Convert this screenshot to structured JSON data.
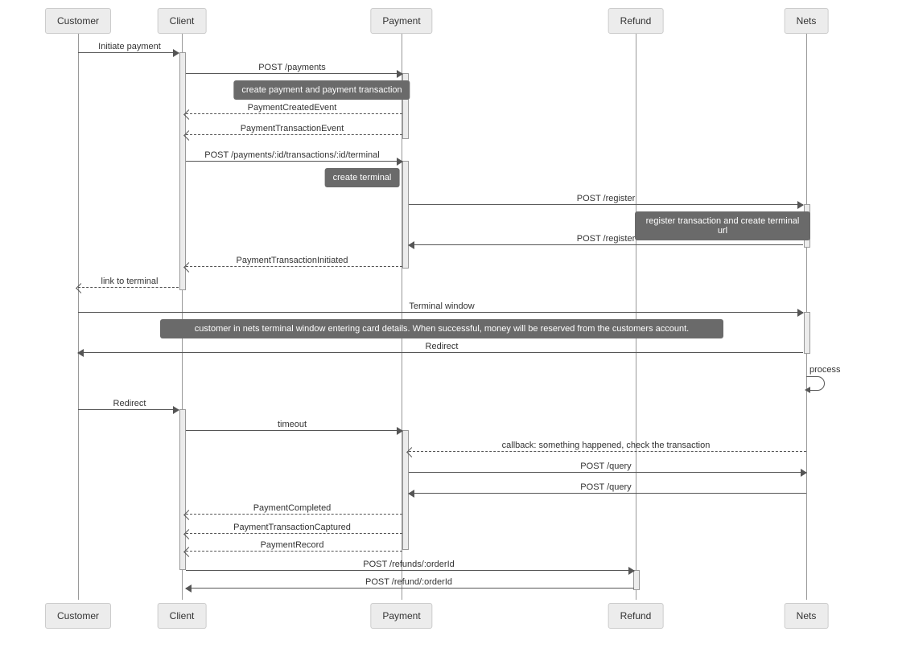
{
  "actors": {
    "customer": "Customer",
    "client": "Client",
    "payment": "Payment",
    "refund": "Refund",
    "nets": "Nets"
  },
  "messages": {
    "m1": "Initiate payment",
    "m2": "POST /payments",
    "m3": "PaymentCreatedEvent",
    "m4": "PaymentTransactionEvent",
    "m5": "POST /payments/:id/transactions/:id/terminal",
    "m6": "POST /register",
    "m7": "POST /register",
    "m8": "PaymentTransactionInitiated",
    "m9": "link to terminal",
    "m10": "Terminal window",
    "m11": "Redirect",
    "m12": "process",
    "m13": "Redirect",
    "m14": "timeout",
    "m15": "callback: something happened, check the transaction",
    "m16": "POST /query",
    "m17": "POST /query",
    "m18": "PaymentCompleted",
    "m19": "PaymentTransactionCaptured",
    "m20": "PaymentRecord",
    "m21": "POST /refunds/:orderId",
    "m22": "POST /refund/:orderId"
  },
  "notes": {
    "n1": "create payment and payment transaction",
    "n2": "create terminal",
    "n3": "register transaction and create terminal url",
    "n4": "customer in nets terminal window entering card details. When successful, money will be reserved from the customers account."
  },
  "chart_data": {
    "type": "sequence-diagram",
    "participants": [
      "Customer",
      "Client",
      "Payment",
      "Refund",
      "Nets"
    ],
    "messages": [
      {
        "from": "Customer",
        "to": "Client",
        "label": "Initiate payment",
        "kind": "sync"
      },
      {
        "from": "Client",
        "to": "Payment",
        "label": "POST /payments",
        "kind": "sync"
      },
      {
        "note_over": [
          "Payment"
        ],
        "text": "create payment and payment transaction"
      },
      {
        "from": "Payment",
        "to": "Client",
        "label": "PaymentCreatedEvent",
        "kind": "return"
      },
      {
        "from": "Payment",
        "to": "Client",
        "label": "PaymentTransactionEvent",
        "kind": "return"
      },
      {
        "from": "Client",
        "to": "Payment",
        "label": "POST /payments/:id/transactions/:id/terminal",
        "kind": "sync"
      },
      {
        "note_over": [
          "Payment"
        ],
        "text": "create terminal"
      },
      {
        "from": "Payment",
        "to": "Nets",
        "label": "POST /register",
        "kind": "sync"
      },
      {
        "note_over": [
          "Nets"
        ],
        "text": "register transaction and create terminal url"
      },
      {
        "from": "Nets",
        "to": "Payment",
        "label": "POST /register",
        "kind": "sync"
      },
      {
        "from": "Payment",
        "to": "Client",
        "label": "PaymentTransactionInitiated",
        "kind": "return"
      },
      {
        "from": "Client",
        "to": "Customer",
        "label": "link to terminal",
        "kind": "return"
      },
      {
        "from": "Customer",
        "to": "Nets",
        "label": "Terminal window",
        "kind": "sync"
      },
      {
        "note_over": [
          "Customer",
          "Nets"
        ],
        "text": "customer in nets terminal window entering card details. When successful, money will be reserved from the customers account."
      },
      {
        "from": "Nets",
        "to": "Customer",
        "label": "Redirect",
        "kind": "sync"
      },
      {
        "from": "Nets",
        "to": "Nets",
        "label": "process",
        "kind": "self"
      },
      {
        "from": "Customer",
        "to": "Client",
        "label": "Redirect",
        "kind": "sync"
      },
      {
        "from": "Client",
        "to": "Payment",
        "label": "timeout",
        "kind": "sync"
      },
      {
        "from": "Nets",
        "to": "Payment",
        "label": "callback: something happened, check the transaction",
        "kind": "return"
      },
      {
        "from": "Payment",
        "to": "Nets",
        "label": "POST /query",
        "kind": "sync"
      },
      {
        "from": "Nets",
        "to": "Payment",
        "label": "POST /query",
        "kind": "sync"
      },
      {
        "from": "Payment",
        "to": "Client",
        "label": "PaymentCompleted",
        "kind": "return"
      },
      {
        "from": "Payment",
        "to": "Client",
        "label": "PaymentTransactionCaptured",
        "kind": "return"
      },
      {
        "from": "Payment",
        "to": "Client",
        "label": "PaymentRecord",
        "kind": "return"
      },
      {
        "from": "Client",
        "to": "Refund",
        "label": "POST /refunds/:orderId",
        "kind": "sync"
      },
      {
        "from": "Refund",
        "to": "Client",
        "label": "POST /refund/:orderId",
        "kind": "sync"
      }
    ]
  }
}
